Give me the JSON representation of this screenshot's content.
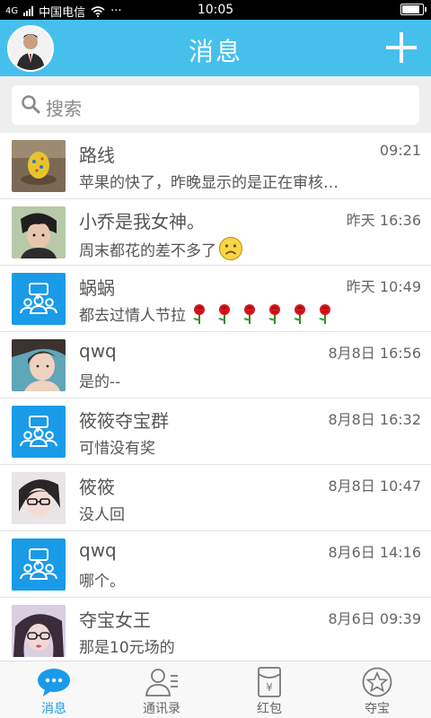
{
  "status_bar": {
    "network": "4G",
    "carrier": "中国电信",
    "more": "···",
    "time": "10:05",
    "battery_level": 0.85
  },
  "header": {
    "title": "消息",
    "accent_color": "#45c0ec"
  },
  "search": {
    "placeholder": "搜索"
  },
  "conversations": [
    {
      "name": "路线",
      "time": "09:21",
      "message": "苹果的快了，昨晚显示的是正在审核…",
      "avatar": "photo-avatar"
    },
    {
      "name": "小乔是我女神。",
      "time": "昨天 16:36",
      "message": "周末都花的差不多了",
      "emoji": "sad-face-icon",
      "avatar": "photo-avatar"
    },
    {
      "name": "蜗蜗",
      "time": "昨天 10:49",
      "message": "都去过情人节拉",
      "emoji": "rose-icon",
      "emoji_count": 6,
      "avatar": "group-avatar-icon"
    },
    {
      "name": "qwq",
      "time": "8月8日 16:56",
      "message": "是的--",
      "avatar": "photo-avatar"
    },
    {
      "name": "筱筱夺宝群",
      "time": "8月8日 16:32",
      "message": "可惜没有奖",
      "avatar": "group-avatar-icon"
    },
    {
      "name": "筱筱",
      "time": "8月8日 10:47",
      "message": "没人回",
      "avatar": "photo-avatar"
    },
    {
      "name": "qwq",
      "time": "8月6日 14:16",
      "message": "哪个。",
      "avatar": "group-avatar-icon"
    },
    {
      "name": "夺宝女王",
      "time": "8月6日 09:39",
      "message": "那是10元场的",
      "avatar": "photo-avatar"
    }
  ],
  "tabs": [
    {
      "label": "消息",
      "icon": "chat-bubble-icon",
      "active": true
    },
    {
      "label": "通讯录",
      "icon": "contacts-icon",
      "active": false
    },
    {
      "label": "红包",
      "icon": "red-packet-icon",
      "active": false
    },
    {
      "label": "夺宝",
      "icon": "star-icon",
      "active": false
    }
  ],
  "colors": {
    "accent": "#45c0ec",
    "tab_active": "#1a9be8",
    "group_avatar": "#1a9be8"
  }
}
